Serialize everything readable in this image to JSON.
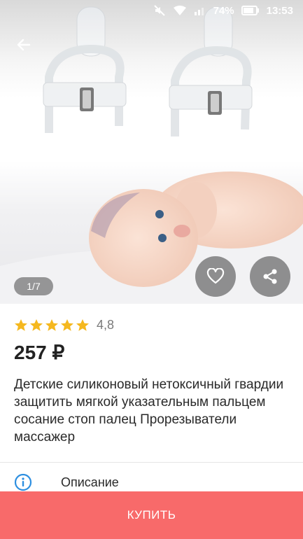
{
  "status_bar": {
    "battery_percent": "74%",
    "time": "13:53",
    "icons": [
      "mute-icon",
      "wifi-icon",
      "signal-icon",
      "battery-icon"
    ]
  },
  "gallery": {
    "pager": "1/7"
  },
  "product": {
    "rating": 4.8,
    "rating_text": "4,8",
    "stars_filled": 5,
    "price": "257 ₽",
    "title": "Детские силиконовый нетоксичный гвардии защитить мягкой указательным пальцем сосание стоп палец Прорезыватели массажер"
  },
  "description": {
    "label": "Описание"
  },
  "buy": {
    "label": "КУПИТЬ"
  },
  "colors": {
    "accent": "#f86a6a",
    "star": "#f5b81f",
    "info_icon": "#2d8fe0"
  }
}
